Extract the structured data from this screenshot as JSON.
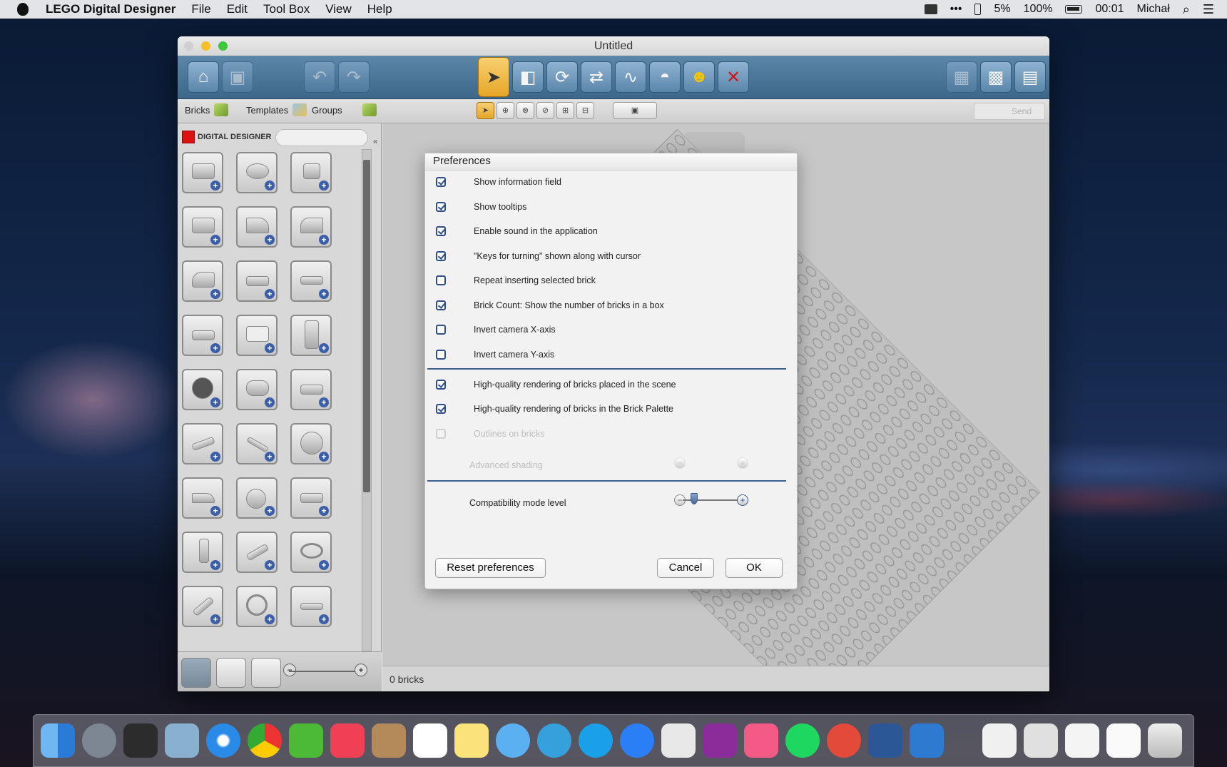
{
  "menubar": {
    "app_name": "LEGO Digital Designer",
    "items": [
      "File",
      "Edit",
      "Tool Box",
      "View",
      "Help"
    ],
    "battery_small": "5%",
    "battery": "100%",
    "time": "00:01",
    "user": "Michał"
  },
  "window": {
    "title": "Untitled",
    "tabs": {
      "bricks": "Bricks",
      "templates": "Templates",
      "groups": "Groups"
    },
    "send_label": "Send",
    "logo_text": "DIGITAL DESIGNER",
    "status": "0 bricks"
  },
  "dialog": {
    "title": "Preferences",
    "options": [
      {
        "label": "Show information field",
        "checked": true
      },
      {
        "label": "Show tooltips",
        "checked": true
      },
      {
        "label": "Enable sound in the application",
        "checked": true
      },
      {
        "label": "\"Keys for turning\" shown along with cursor",
        "checked": true
      },
      {
        "label": "Repeat inserting selected brick",
        "checked": false
      },
      {
        "label": "Brick Count: Show the number of bricks in a box",
        "checked": true
      },
      {
        "label": "Invert camera X-axis",
        "checked": false
      },
      {
        "label": "Invert camera Y-axis",
        "checked": false
      }
    ],
    "render_options": [
      {
        "label": "High-quality rendering of bricks placed in the scene",
        "checked": true
      },
      {
        "label": "High-quality rendering of bricks in the Brick Palette",
        "checked": true
      },
      {
        "label": "Outlines on bricks",
        "checked": false,
        "disabled": true
      }
    ],
    "advanced_shading": "Advanced shading",
    "compatibility_label": "Compatibility mode level",
    "compatibility_level": 0.2,
    "reset_label": "Reset preferences",
    "cancel_label": "Cancel",
    "ok_label": "OK"
  },
  "colors": {
    "accent": "#3e5e92",
    "toolbar": "#4a759a",
    "selected": "#f0c050"
  }
}
